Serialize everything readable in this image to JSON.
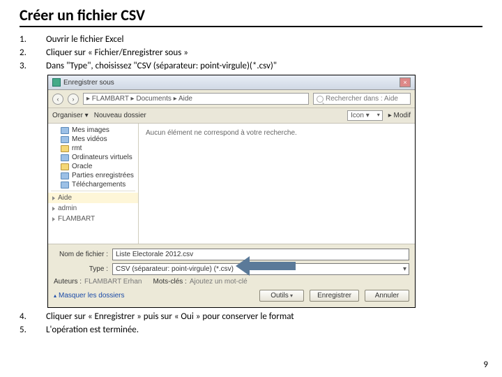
{
  "title": "Créer un fichier CSV",
  "steps": {
    "s1": {
      "n": "1.",
      "t": "Ouvrir le fichier Excel"
    },
    "s2": {
      "n": "2.",
      "t": "Cliquer sur « Fichier/Enregistrer sous »"
    },
    "s3": {
      "n": "3.",
      "t": "Dans \"Type\", choisissez \"CSV (séparateur: point-virgule)(*.csv)\""
    },
    "s4": {
      "n": "4.",
      "t": "Cliquer sur « Enregistrer » puis sur « Oui » pour conserver le format"
    },
    "s5": {
      "n": "5.",
      "t": "L'opération est terminée."
    }
  },
  "dialog": {
    "title": "Enregistrer sous",
    "path": "▸ FLAMBART ▸ Documents ▸ Aide",
    "search_ph": "Rechercher dans : Aide",
    "organize": "Organiser ▾",
    "newfolder": "Nouveau dossier",
    "iconview": "Icon ▾",
    "modify": "▸ Modif",
    "side_items": [
      "Mes images",
      "Mes vidéos",
      "rmt",
      "Ordinateurs virtuels",
      "Oracle",
      "Parties enregistrées",
      "Téléchargements"
    ],
    "side_groups": [
      "Aide",
      "admin",
      "FLAMBART"
    ],
    "empty_msg": "Aucun élément ne correspond à votre recherche.",
    "lbl_name": "Nom de fichier :",
    "val_name": "Liste Electorale 2012.csv",
    "lbl_type": "Type :",
    "val_type": "CSV (séparateur: point-virgule) (*.csv)",
    "lbl_auth": "Auteurs :",
    "val_auth": "FLAMBART Erhan",
    "lbl_tags": "Mots-clés :",
    "val_tags": "Ajoutez un mot-clé",
    "hide": "Masquer les dossiers",
    "tools": "Outils",
    "save": "Enregistrer",
    "cancel": "Annuler"
  },
  "page_number": "9"
}
